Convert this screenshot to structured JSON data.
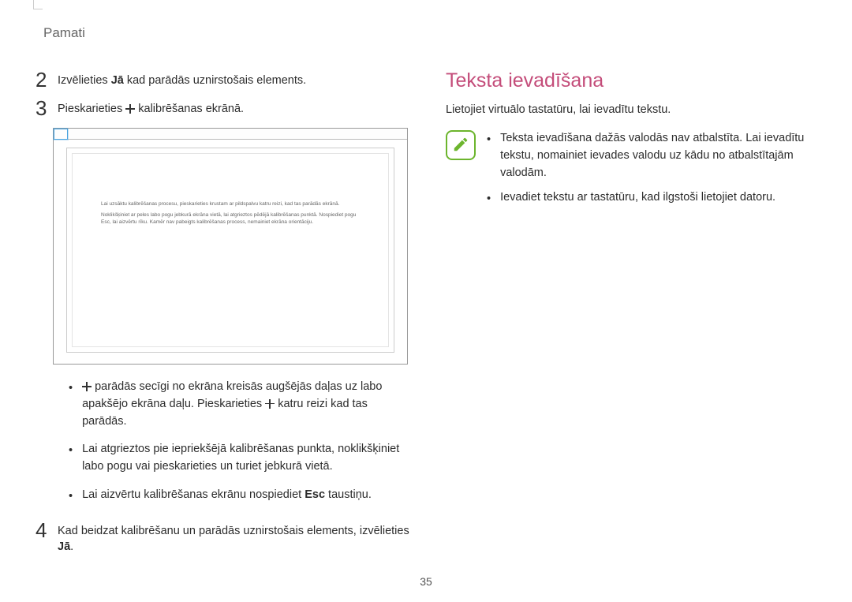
{
  "header": {
    "section": "Pamati"
  },
  "left": {
    "step2": {
      "num": "2",
      "prefix": "Izvēlieties ",
      "bold": "Jā",
      "suffix": " kad parādās uznirstošais elements."
    },
    "step3": {
      "num": "3",
      "prefix": "Pieskarieties ",
      "suffix": " kalibrēšanas ekrānā."
    },
    "calib": {
      "line1": "Lai uzsāktu kalibrēšanas procesu, pieskarieties krustam ar pildspalvu katru reizi, kad tas parādās ekrānā.",
      "line2": "Noklikšķiniet ar peles labo pogu jebkurā ekrāna vietā, lai atgrieztos pēdējā kalibrēšanas punktā. Nospiediet pogu Esc, lai aizvērtu rīku. Kamēr nav pabeigts kalibrēšanas process, nemainiet ekrāna orientāciju."
    },
    "bulletA": {
      "pre": "",
      "mid1": " parādās secīgi no ekrāna kreisās augšējās daļas uz labo apakšējo ekrāna daļu. Pieskarieties ",
      "mid2": " katru reizi kad tas parādās."
    },
    "bulletB": "Lai atgrieztos pie iepriekšējā kalibrēšanas punkta, noklikšķiniet labo pogu vai pieskarieties un turiet jebkurā vietā.",
    "bulletC": {
      "pre": "Lai aizvērtu kalibrēšanas ekrānu nospiediet ",
      "bold": "Esc",
      "post": " taustiņu."
    },
    "step4": {
      "num": "4",
      "pre": "Kad beidzat kalibrēšanu un parādās uznirstošais elements, izvēlieties ",
      "bold": "Jā",
      "post": "."
    }
  },
  "right": {
    "title": "Teksta ievadīšana",
    "desc": "Lietojiet virtuālo tastatūru, lai ievadītu tekstu.",
    "note1": "Teksta ievadīšana dažās valodās nav atbalstīta. Lai ievadītu tekstu, nomainiet ievades valodu uz kādu no atbalstītajām valodām.",
    "note2": "Ievadiet tekstu ar tastatūru, kad ilgstoši lietojiet datoru."
  },
  "pageNumber": "35"
}
